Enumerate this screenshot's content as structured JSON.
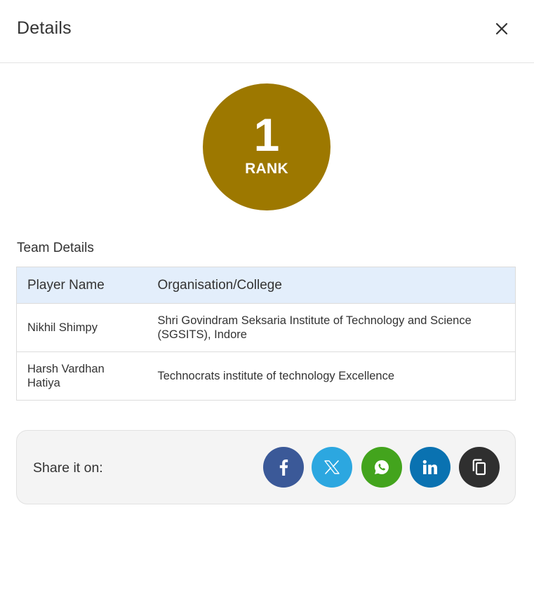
{
  "dialog": {
    "title": "Details",
    "close_icon": "close-icon"
  },
  "rank": {
    "number": "1",
    "label": "RANK",
    "color": "#9d7800"
  },
  "team": {
    "section_title": "Team Details",
    "columns": [
      "Player Name",
      "Organisation/College"
    ],
    "rows": [
      {
        "player": "Nikhil Shimpy",
        "organisation": "Shri Govindram Seksaria Institute of Technology and Science (SGSITS), Indore"
      },
      {
        "player": "Harsh Vardhan Hatiya",
        "organisation": "Technocrats institute of technology Excellence"
      }
    ]
  },
  "share": {
    "label": "Share it on:",
    "buttons": [
      {
        "name": "facebook",
        "icon": "facebook-icon",
        "color": "#3b5998"
      },
      {
        "name": "x",
        "icon": "x-icon",
        "color": "#2ca7e0"
      },
      {
        "name": "whatsapp",
        "icon": "whatsapp-icon",
        "color": "#43a41d"
      },
      {
        "name": "linkedin",
        "icon": "linkedin-icon",
        "color": "#0a72b1"
      },
      {
        "name": "copy",
        "icon": "copy-icon",
        "color": "#2f2f2f"
      }
    ]
  }
}
